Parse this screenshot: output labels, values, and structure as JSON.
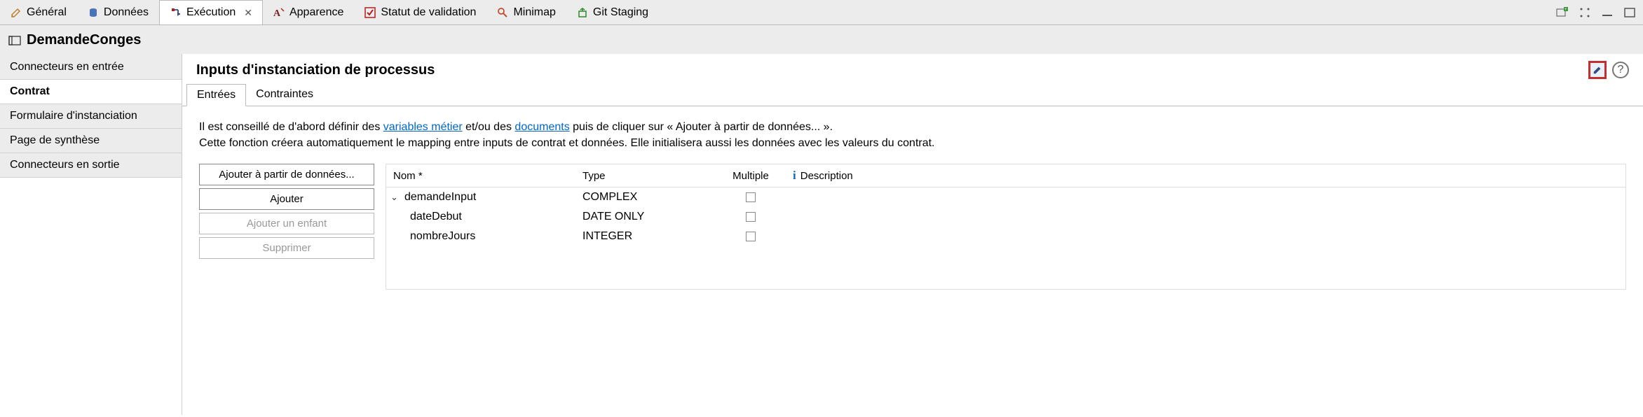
{
  "tabs": [
    {
      "label": "Général",
      "icon": "pencil"
    },
    {
      "label": "Données",
      "icon": "cylinder"
    },
    {
      "label": "Exécution",
      "icon": "execute",
      "active": true
    },
    {
      "label": "Apparence",
      "icon": "font"
    },
    {
      "label": "Statut de validation",
      "icon": "checkbox"
    },
    {
      "label": "Minimap",
      "icon": "magnifier"
    },
    {
      "label": "Git Staging",
      "icon": "git"
    }
  ],
  "title": "DemandeConges",
  "sidebar": [
    {
      "label": "Connecteurs en entrée"
    },
    {
      "label": "Contrat",
      "selected": true
    },
    {
      "label": "Formulaire d'instanciation"
    },
    {
      "label": "Page de synthèse"
    },
    {
      "label": "Connecteurs en sortie"
    }
  ],
  "panel": {
    "title": "Inputs d'instanciation de processus",
    "subtabs": [
      {
        "label": "Entrées",
        "active": true
      },
      {
        "label": "Contraintes"
      }
    ],
    "help": {
      "part1": "Il est conseillé de d'abord définir des ",
      "link1": "variables métier",
      "part2": " et/ou des ",
      "link2": "documents",
      "part3": " puis de cliquer sur « Ajouter à partir de données... ».",
      "line2": "Cette fonction créera automatiquement le mapping entre inputs de contrat et données. Elle initialisera aussi les données avec les valeurs du contrat."
    },
    "buttons": {
      "addFromData": "Ajouter à partir de données...",
      "add": "Ajouter",
      "addChild": "Ajouter un enfant",
      "delete": "Supprimer"
    },
    "columns": {
      "name": "Nom *",
      "type": "Type",
      "multiple": "Multiple",
      "description": "Description"
    },
    "rows": [
      {
        "name": "demandeInput",
        "type": "COMPLEX",
        "multiple": false,
        "indent": 0,
        "expandable": true
      },
      {
        "name": "dateDebut",
        "type": "DATE ONLY",
        "multiple": false,
        "indent": 1
      },
      {
        "name": "nombreJours",
        "type": "INTEGER",
        "multiple": false,
        "indent": 1
      }
    ]
  }
}
